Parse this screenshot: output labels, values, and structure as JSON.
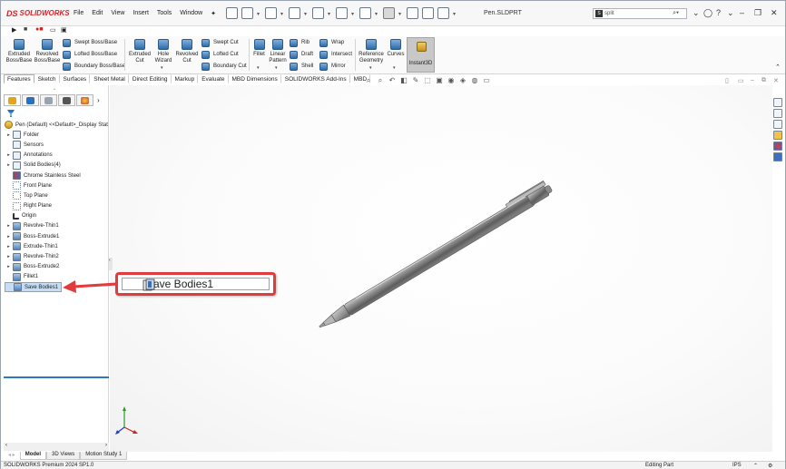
{
  "app": {
    "brand": "SOLIDWORKS",
    "brand_mark": "DS",
    "menus": [
      "File",
      "Edit",
      "View",
      "Insert",
      "Tools",
      "Window"
    ],
    "document_title": "Pen.SLDPRT",
    "search_value": "split"
  },
  "commands": {
    "extruded_boss": "Extruded Boss/Base",
    "revolved_boss": "Revolved Boss/Base",
    "swept_boss": "Swept Boss/Base",
    "lofted_boss": "Lofted Boss/Base",
    "boundary_boss": "Boundary Boss/Base",
    "extruded_cut": "Extruded Cut",
    "hole_wizard": "Hole Wizard",
    "revolved_cut": "Revolved Cut",
    "swept_cut": "Swept Cut",
    "lofted_cut": "Lofted Cut",
    "boundary_cut": "Boundary Cut",
    "fillet": "Fillet",
    "linear_pattern": "Linear Pattern",
    "rib": "Rib",
    "draft": "Draft",
    "shell": "Shell",
    "wrap": "Wrap",
    "intersect": "Intersect",
    "mirror": "Mirror",
    "reference_geometry": "Reference Geometry",
    "curves": "Curves",
    "instant3d": "Instant3D"
  },
  "tabs": [
    "Features",
    "Sketch",
    "Surfaces",
    "Sheet Metal",
    "Direct Editing",
    "Markup",
    "Evaluate",
    "MBD Dimensions",
    "SOLIDWORKS Add-Ins",
    "MBD"
  ],
  "feature_tree": {
    "root": "Pen (Default) <<Default>_Display Stat",
    "items": [
      {
        "label": "Folder",
        "expand": "▸",
        "kind": "folder"
      },
      {
        "label": "Sensors",
        "expand": "",
        "kind": "sensor"
      },
      {
        "label": "Annotations",
        "expand": "▸",
        "kind": "annot"
      },
      {
        "label": "Solid Bodies(4)",
        "expand": "▸",
        "kind": "bodies"
      },
      {
        "label": "Chrome Stainless Steel",
        "expand": "",
        "kind": "mat"
      },
      {
        "label": "Front Plane",
        "expand": "",
        "kind": "plane"
      },
      {
        "label": "Top Plane",
        "expand": "",
        "kind": "plane"
      },
      {
        "label": "Right Plane",
        "expand": "",
        "kind": "plane"
      },
      {
        "label": "Origin",
        "expand": "",
        "kind": "origin"
      },
      {
        "label": "Revolve-Thin1",
        "expand": "▸",
        "kind": "feat"
      },
      {
        "label": "Boss-Extrude1",
        "expand": "▸",
        "kind": "feat"
      },
      {
        "label": "Extrude-Thin1",
        "expand": "▸",
        "kind": "feat"
      },
      {
        "label": "Revolve-Thin2",
        "expand": "▸",
        "kind": "feat"
      },
      {
        "label": "Boss-Extrude2",
        "expand": "▸",
        "kind": "feat"
      },
      {
        "label": "Fillet1",
        "expand": "",
        "kind": "feat"
      },
      {
        "label": "Save Bodies1",
        "expand": "",
        "kind": "save"
      }
    ]
  },
  "callout": {
    "label": "Save Bodies1",
    "border_color": "#e23b3b"
  },
  "bottom_tabs": [
    "Model",
    "3D Views",
    "Motion Study 1"
  ],
  "status": {
    "product": "SOLIDWORKS Premium 2024 SP1.0",
    "mode": "Editing Part",
    "units": "IPS"
  }
}
